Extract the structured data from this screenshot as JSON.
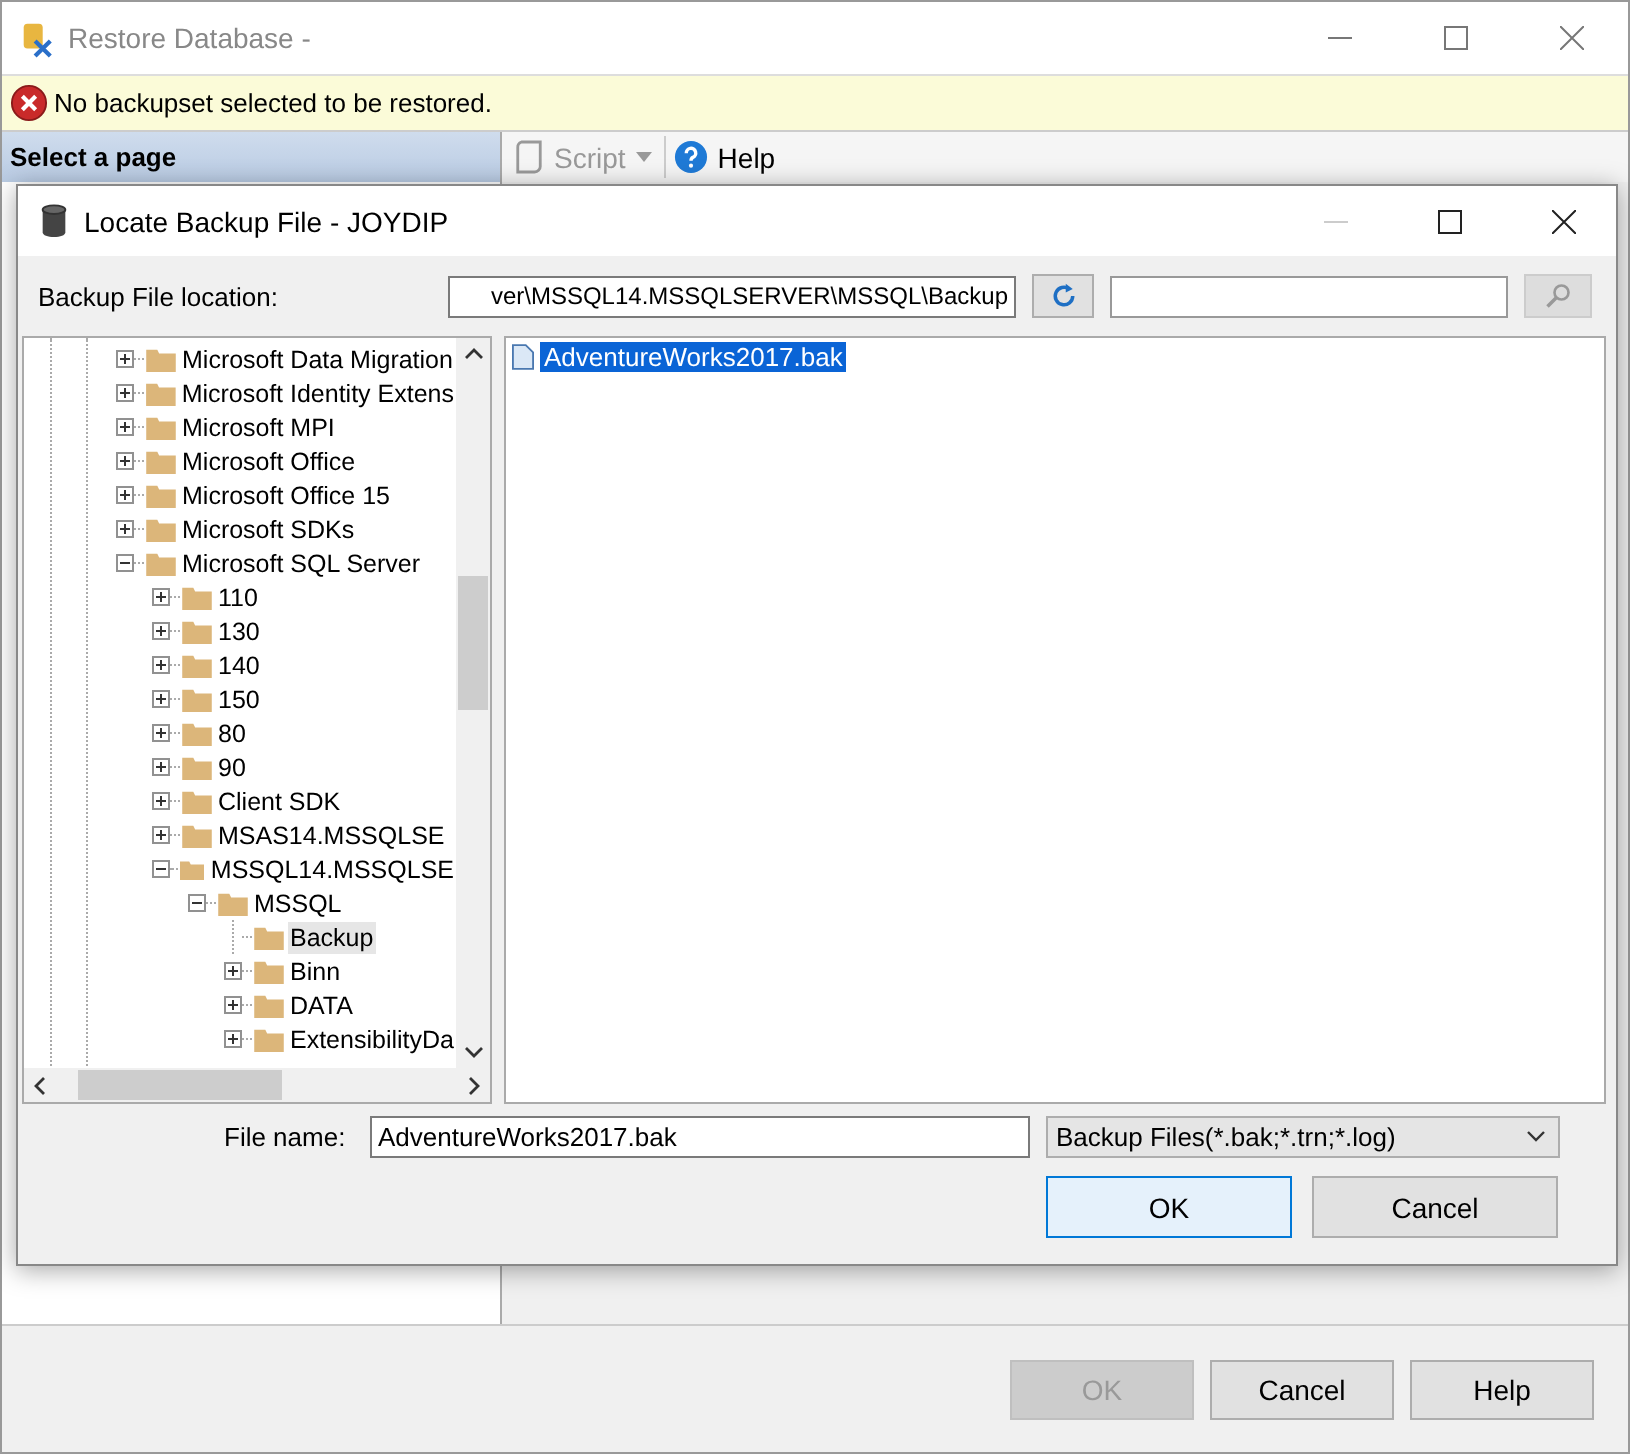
{
  "window": {
    "title": "Restore Database -",
    "error": "No backupset selected to be restored."
  },
  "sidebar": {
    "header": "Select a page"
  },
  "toolbar": [
    {
      "label": "Script",
      "disabled": true,
      "kind": "script"
    },
    {
      "label": "Help",
      "disabled": false,
      "kind": "help"
    }
  ],
  "buttons": [
    {
      "label": "OK",
      "disabled": true
    },
    {
      "label": "Cancel",
      "disabled": false
    },
    {
      "label": "Help",
      "disabled": false
    }
  ],
  "dialog": {
    "title": "Locate Backup File - JOYDIP",
    "location_label": "Backup File location:",
    "location_value": "ver\\MSSQL14.MSSQLSERVER\\MSSQL\\Backup",
    "tree": [
      {
        "label": "Microsoft Data Migration",
        "expanded": false,
        "selected": false
      },
      {
        "label": "Microsoft Identity Extens",
        "expanded": false,
        "selected": false
      },
      {
        "label": "Microsoft MPI",
        "expanded": false,
        "selected": false
      },
      {
        "label": "Microsoft Office",
        "expanded": false,
        "selected": false
      },
      {
        "label": "Microsoft Office 15",
        "expanded": false,
        "selected": false
      },
      {
        "label": "Microsoft SDKs",
        "expanded": false,
        "selected": false
      },
      {
        "label": "Microsoft SQL Server",
        "expanded": true,
        "selected": false,
        "children": [
          {
            "label": "110",
            "expanded": false,
            "selected": false
          },
          {
            "label": "130",
            "expanded": false,
            "selected": false
          },
          {
            "label": "140",
            "expanded": false,
            "selected": false
          },
          {
            "label": "150",
            "expanded": false,
            "selected": false
          },
          {
            "label": "80",
            "expanded": false,
            "selected": false
          },
          {
            "label": "90",
            "expanded": false,
            "selected": false
          },
          {
            "label": "Client SDK",
            "expanded": false,
            "selected": false
          },
          {
            "label": "MSAS14.MSSQLSE",
            "expanded": false,
            "selected": false
          },
          {
            "label": "MSSQL14.MSSQLSE",
            "expanded": true,
            "selected": false,
            "children": [
              {
                "label": "MSSQL",
                "expanded": true,
                "selected": false,
                "children": [
                  {
                    "label": "Backup",
                    "selected": true
                  },
                  {
                    "label": "Binn",
                    "expanded": false,
                    "selected": false
                  },
                  {
                    "label": "DATA",
                    "expanded": false,
                    "selected": false
                  },
                  {
                    "label": "ExtensibilityDa",
                    "expanded": false,
                    "selected": false
                  }
                ]
              }
            ]
          }
        ]
      }
    ],
    "files": [
      {
        "name": "AdventureWorks2017.bak",
        "selected": true
      }
    ],
    "file_name_label": "File name:",
    "file_name_value": "AdventureWorks2017.bak",
    "file_type": "Backup Files(*.bak;*.trn;*.log)",
    "buttons": [
      {
        "label": "OK",
        "focused": true
      },
      {
        "label": "Cancel",
        "focused": false
      }
    ]
  }
}
